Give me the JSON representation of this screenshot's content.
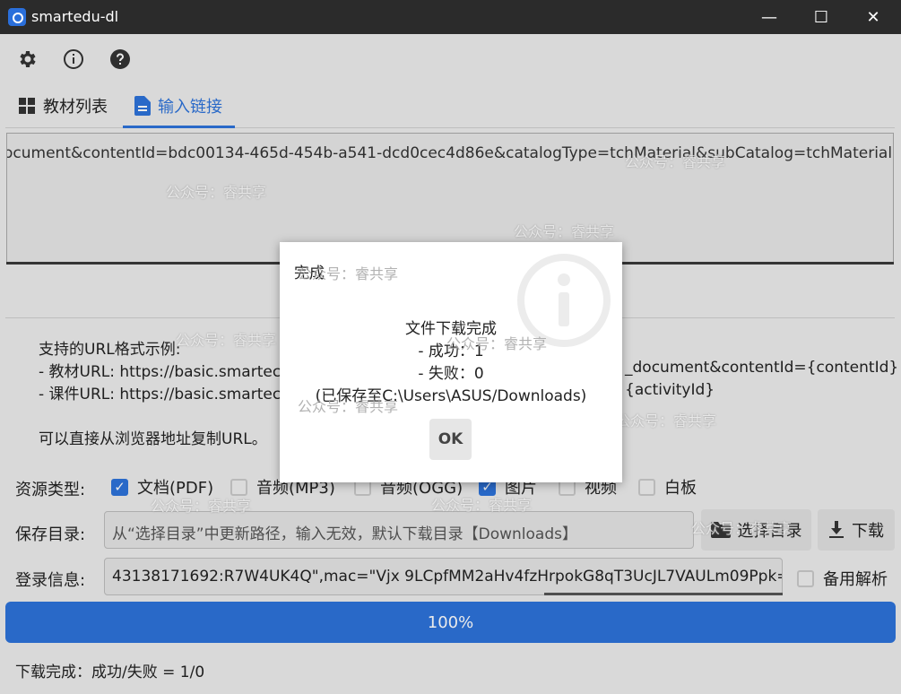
{
  "window": {
    "title": "smartedu-dl",
    "minimize": "—",
    "maximize": "☐",
    "close": "✕"
  },
  "toolbar": {
    "icons": [
      "gear-icon",
      "info-icon",
      "help-icon"
    ]
  },
  "tabs": [
    {
      "label": "教材列表",
      "icon": "grid-icon",
      "active": false
    },
    {
      "label": "输入链接",
      "icon": "document-icon",
      "active": true
    }
  ],
  "url_input": {
    "value": "ocument&contentId=bdc00134-465d-454b-a541-dcd0cec4d86e&catalogType=tchMaterial&subCatalog=tchMaterial"
  },
  "help": {
    "heading": "支持的URL格式示例:",
    "line1_left": "- 教材URL: https://basic.smartec",
    "line1_right": "_document&contentId={contentId}",
    "line2_left": "- 课件URL: https://basic.smartec",
    "line2_right": "{activityId}",
    "note": "可以直接从浏览器地址复制URL。"
  },
  "resource": {
    "label": "资源类型:",
    "options": [
      {
        "label": "文档(PDF)",
        "checked": true
      },
      {
        "label": "音频(MP3)",
        "checked": false
      },
      {
        "label": "音频(OGG)",
        "checked": false
      },
      {
        "label": "图片",
        "checked": true
      },
      {
        "label": "视频",
        "checked": false
      },
      {
        "label": "白板",
        "checked": false
      }
    ]
  },
  "save": {
    "label": "保存目录:",
    "placeholder": "从“选择目录”中更新路径，输入无效，默认下载目录【Downloads】",
    "choose_button": "选择目录",
    "download_button": "下载"
  },
  "login": {
    "label": "登录信息:",
    "value": "43138171692:R7W4UK4Q\",mac=\"Vjx 9LCpfMM2aHv4fzHrpokG8qT3UcJL7VAULm09Ppk=\"",
    "backup_label": "备用解析",
    "backup_checked": false
  },
  "progress": {
    "value": 1.0,
    "text": "100%"
  },
  "status": "下载完成：成功/失败 = 1/0",
  "dialog": {
    "title": "完成",
    "line1": "文件下载完成",
    "line2": "- 成功：1",
    "line3": "- 失败：0",
    "line4": "(已保存至C:\\Users\\ASUS/Downloads)",
    "ok": "OK"
  },
  "watermark": "公众号：睿共享"
}
